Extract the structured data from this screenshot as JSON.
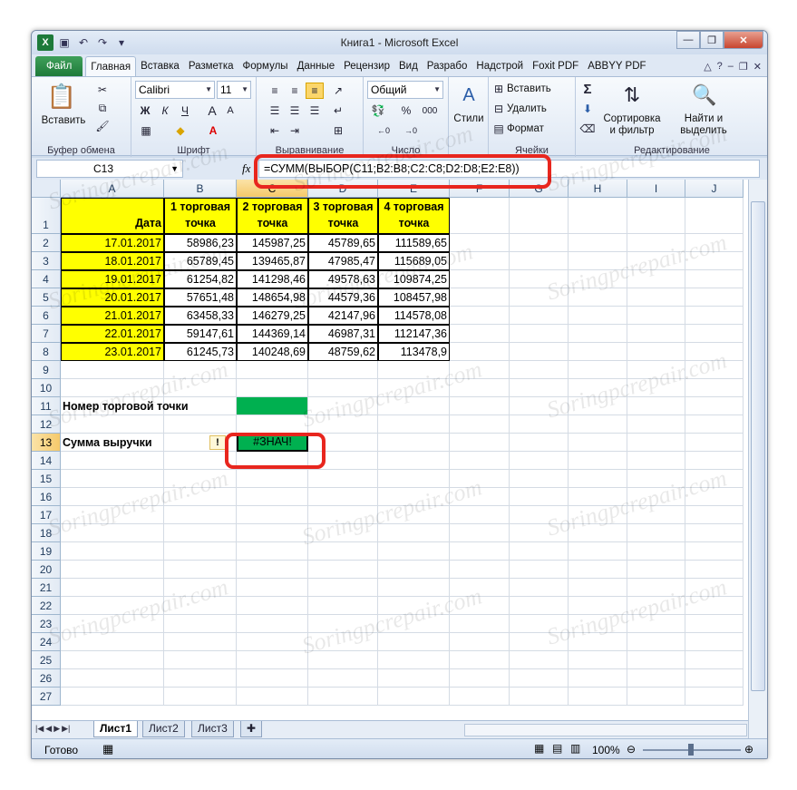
{
  "window": {
    "title": "Книга1 - Microsoft Excel"
  },
  "tabs": [
    "Файл",
    "Главная",
    "Вставка",
    "Разметка",
    "Формулы",
    "Данные",
    "Рецензир",
    "Вид",
    "Разрабо",
    "Надстрой",
    "Foxit PDF",
    "ABBYY PDF"
  ],
  "ribbon": {
    "clipboard": {
      "paste": "Вставить",
      "label": "Буфер обмена"
    },
    "font": {
      "name": "Calibri",
      "size": "11",
      "label": "Шрифт",
      "bold": "Ж",
      "italic": "К",
      "underline": "Ч"
    },
    "alignment": {
      "label": "Выравнивание"
    },
    "number": {
      "format": "Общий",
      "label": "Число",
      "percent": "%",
      "thousands": "000"
    },
    "styles": {
      "button": "Стили"
    },
    "cells": {
      "insert": "Вставить",
      "delete": "Удалить",
      "format": "Формат",
      "label": "Ячейки"
    },
    "editing": {
      "sort_filter": "Сортировка и фильтр",
      "find_select": "Найти и выделить",
      "label": "Редактирование",
      "sigma": "Σ"
    }
  },
  "formula_bar": {
    "name_box": "C13",
    "fx": "fx",
    "formula": "=СУММ(ВЫБОР(C11;B2:B8;C2:C8;D2:D8;E2:E8))"
  },
  "columns": [
    "A",
    "B",
    "C",
    "D",
    "E",
    "F",
    "G",
    "H",
    "I",
    "J"
  ],
  "rows": [
    "1",
    "2",
    "3",
    "4",
    "5",
    "6",
    "7",
    "8",
    "9",
    "10",
    "11",
    "12",
    "13",
    "14",
    "15",
    "16",
    "17",
    "18",
    "19",
    "20",
    "21",
    "22",
    "23",
    "24",
    "25",
    "26",
    "27"
  ],
  "table": {
    "headers": [
      "Дата",
      "1 торговая точка",
      "2 торговая точка",
      "3 торговая точка",
      "4 торговая точка"
    ],
    "data": [
      [
        "17.01.2017",
        "58986,23",
        "145987,25",
        "45789,65",
        "111589,65"
      ],
      [
        "18.01.2017",
        "65789,45",
        "139465,87",
        "47985,47",
        "115689,05"
      ],
      [
        "19.01.2017",
        "61254,82",
        "141298,46",
        "49578,63",
        "109874,25"
      ],
      [
        "20.01.2017",
        "57651,48",
        "148654,98",
        "44579,36",
        "108457,98"
      ],
      [
        "21.01.2017",
        "63458,33",
        "146279,25",
        "42147,96",
        "114578,08"
      ],
      [
        "22.01.2017",
        "59147,61",
        "144369,14",
        "46987,31",
        "112147,36"
      ],
      [
        "23.01.2017",
        "61245,73",
        "140248,69",
        "48759,62",
        "113478,9"
      ]
    ]
  },
  "labels": {
    "store_number": "Номер торговой точки",
    "revenue_sum": "Сумма выручки",
    "result": "#ЗНАЧ!",
    "warning": "!"
  },
  "sheets": [
    "Лист1",
    "Лист2",
    "Лист3"
  ],
  "status": {
    "ready": "Готово",
    "zoom": "100%"
  },
  "watermark": "Soringpcrepair.com",
  "colors": {
    "yellow": "#ffff00",
    "green": "#00b050",
    "highlight": "#e8261e"
  }
}
